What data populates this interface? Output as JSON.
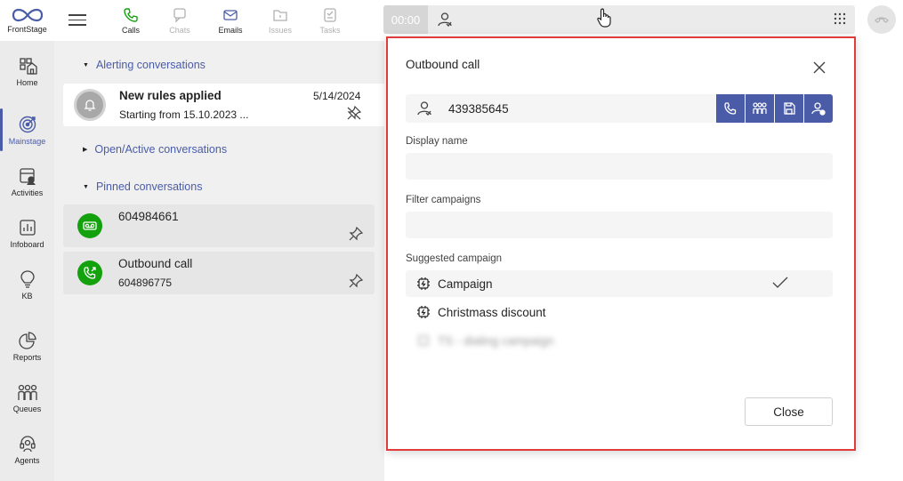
{
  "app": {
    "logo_text": "FrontStage"
  },
  "rail": {
    "items": [
      {
        "label": "Home",
        "icon": "home-icon"
      },
      {
        "label": "Mainstage",
        "icon": "target-icon",
        "active": true
      },
      {
        "label": "Activities",
        "icon": "activities-icon"
      },
      {
        "label": "Infoboard",
        "icon": "infoboard-icon"
      },
      {
        "label": "KB",
        "icon": "lightbulb-icon"
      },
      {
        "label": "Reports",
        "icon": "pie-chart-icon"
      },
      {
        "label": "Queues",
        "icon": "queues-icon"
      },
      {
        "label": "Agents",
        "icon": "headset-icon"
      }
    ]
  },
  "topnav": {
    "calls": "Calls",
    "chats": "Chats",
    "emails": "Emails",
    "issues": "Issues",
    "tasks": "Tasks"
  },
  "callbar": {
    "timer": "00:00"
  },
  "conversations": {
    "alerting_header": "Alerting conversations",
    "alert": {
      "title": "New rules applied",
      "subtitle": "Starting from 15.10.2023 ...",
      "date": "5/14/2024"
    },
    "open_header": "Open/Active conversations",
    "pinned_header": "Pinned conversations",
    "pinned": [
      {
        "title": "604984661",
        "subtitle": ""
      },
      {
        "title": "Outbound call",
        "subtitle": "604896775"
      }
    ]
  },
  "dialog": {
    "title": "Outbound call",
    "phone_value": "439385645",
    "display_name_label": "Display name",
    "display_name_value": "",
    "filter_label": "Filter campaigns",
    "filter_value": "",
    "suggested_label": "Suggested campaign",
    "campaigns": [
      {
        "name": "Campaign",
        "selected": true
      },
      {
        "name": "Christmass discount",
        "selected": false
      },
      {
        "name": "TS - dialing campaign",
        "selected": false,
        "blurred": true
      }
    ],
    "close_label": "Close"
  },
  "colors": {
    "accent": "#4a5ca8",
    "green": "#13a10e",
    "highlight_border": "#e03c3c"
  }
}
